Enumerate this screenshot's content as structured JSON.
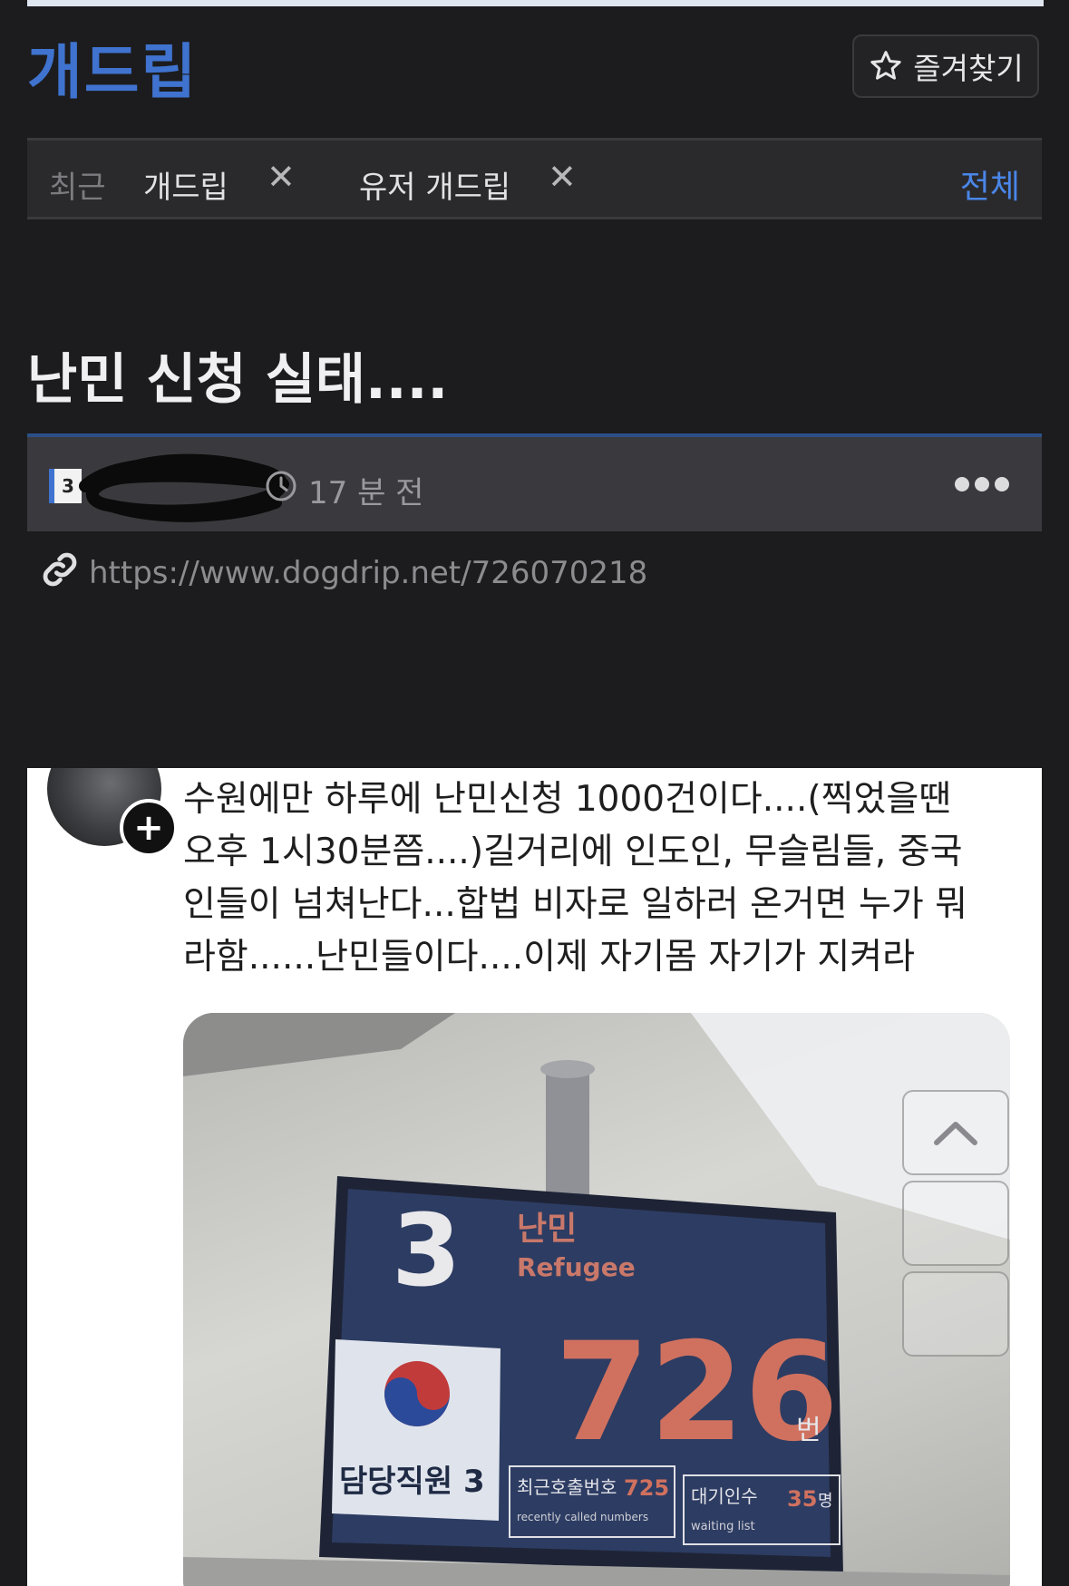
{
  "header": {
    "logo": "개드립",
    "favorites_label": "즐겨찾기"
  },
  "recent": {
    "label": "최근",
    "chips": [
      "개드립",
      "유저 개드립"
    ],
    "all_label": "전체"
  },
  "post": {
    "title": "난민 신청 실태....",
    "author_level": "3",
    "time": "17 분 전",
    "url": "https://www.dogdrip.net/726070218"
  },
  "content": {
    "caption_lines": [
      "수원에만 하루에 난민신청 1000건이다....(찍었을땐",
      "오후 1시30분쯤....)길거리에 인도인, 무슬림들, 중국",
      "인들이 넘쳐난다...합법 비자로 일하러 온거면 누가 뭐",
      "라함......난민들이다....이제 자기몸 자기가 지켜라"
    ],
    "sign": {
      "window_number": "3",
      "category_ko": "난민",
      "category_en": "Refugee",
      "current_number": "726",
      "number_unit": "번",
      "staff_label": "담당직원 3",
      "recent_called_label": "최근호출번호",
      "recent_called_value": "725",
      "recent_called_en": "recently called numbers",
      "waiting_label": "대기인수",
      "waiting_value": "35",
      "waiting_unit": "명",
      "waiting_en": "waiting list"
    }
  },
  "colors": {
    "accent": "#3f73cf",
    "background": "#1c1c1e",
    "sign_number": "#d0715f"
  }
}
